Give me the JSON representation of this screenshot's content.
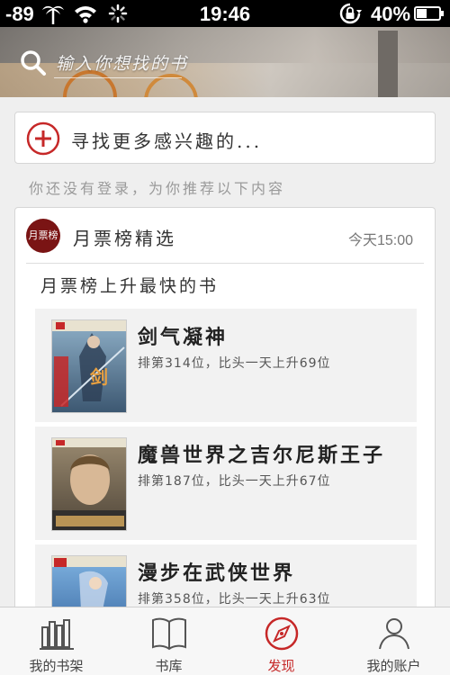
{
  "status_bar": {
    "signal": "-89",
    "time": "19:46",
    "battery": "40%"
  },
  "search": {
    "placeholder": "输入你想找的书"
  },
  "find_more": {
    "label": "寻找更多感兴趣的..."
  },
  "login_notice": "你还没有登录，为你推荐以下内容",
  "feed_card": {
    "avatar_text": "月票榜",
    "title": "月票榜精选",
    "time": "今天15:00",
    "section_title": "月票榜上升最快的书",
    "books": [
      {
        "name": "剑气凝神",
        "info": "排第314位，比头一天上升69位",
        "cover_color": "#4a6a8c"
      },
      {
        "name": "魔兽世界之吉尔尼斯王子",
        "info": "排第187位，比头一天上升67位",
        "cover_color": "#7a6a58"
      },
      {
        "name": "漫步在武侠世界",
        "info": "排第358位，比头一天上升63位",
        "cover_color": "#3f6fa6"
      }
    ]
  },
  "tabbar": {
    "items": [
      {
        "label": "我的书架",
        "icon": "bookshelf-icon",
        "active": false
      },
      {
        "label": "书库",
        "icon": "book-icon",
        "active": false
      },
      {
        "label": "发现",
        "icon": "compass-icon",
        "active": true
      },
      {
        "label": "我的账户",
        "icon": "user-icon",
        "active": false
      }
    ]
  },
  "colors": {
    "accent": "#c62828",
    "background": "#efefef"
  }
}
